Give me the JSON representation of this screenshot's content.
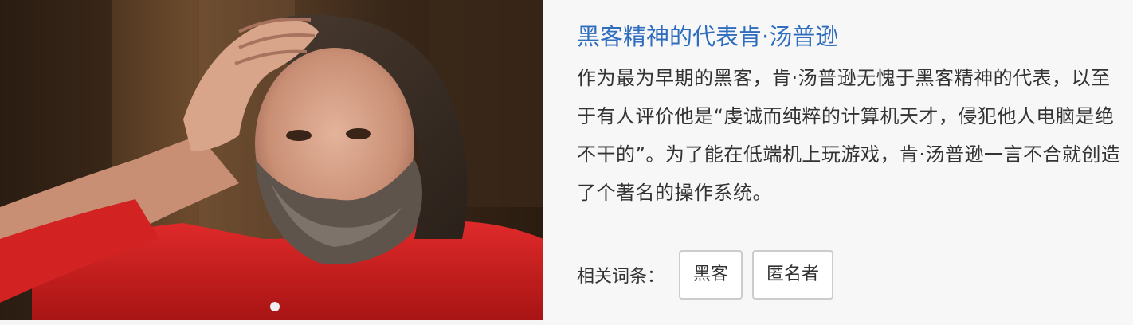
{
  "article": {
    "title": "黑客精神的代表肯·汤普逊",
    "description": "作为最为早期的黑客，肯·汤普逊无愧于黑客精神的代表，以至于有人评价他是“虔诚而纯粹的计算机天才，侵犯他人电脑是绝不干的”。为了能在低端机上玩游戏，肯·汤普逊一言不合就创造了个著名的操作系统。",
    "related_label": "相关词条：",
    "tags": [
      {
        "label": "黑客"
      },
      {
        "label": "匿名者"
      }
    ]
  },
  "colors": {
    "title": "#2f6dbf",
    "text": "#333333",
    "background": "#f7f7f7",
    "shirt": "#d32222"
  }
}
